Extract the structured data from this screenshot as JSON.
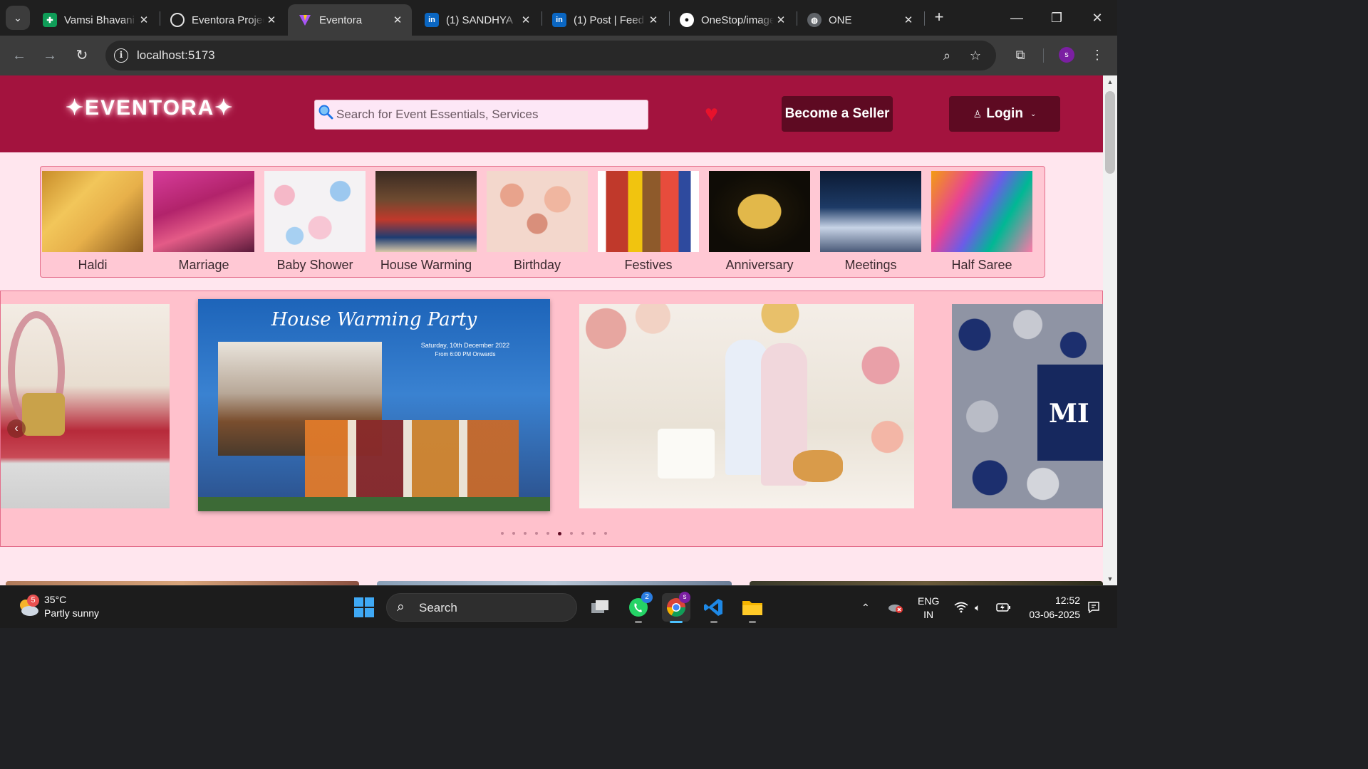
{
  "browser": {
    "tabs": [
      {
        "title": "Vamsi Bhavani",
        "favicon": "google-sheets-icon",
        "active": false
      },
      {
        "title": "Eventora Project",
        "favicon": "chatgpt-icon",
        "active": false
      },
      {
        "title": "Eventora",
        "favicon": "vite-icon",
        "active": true
      },
      {
        "title": "(1) SANDHYA",
        "favicon": "linkedin-icon",
        "active": false
      },
      {
        "title": "(1) Post | Feed",
        "favicon": "linkedin-icon",
        "active": false
      },
      {
        "title": "OneStop/images",
        "favicon": "github-icon",
        "active": false
      },
      {
        "title": "ONE",
        "favicon": "globe-icon",
        "active": false
      }
    ],
    "url": "localhost:5173",
    "profile_initial": "s"
  },
  "site": {
    "logo": "✦EVENTORA✦",
    "search_placeholder": "Search for Event Essentials, Services",
    "seller_button": "Become a Seller",
    "login_button": "Login",
    "brand_color": "#a3133e",
    "button_color": "#5e0a22",
    "categories": [
      {
        "label": "Haldi"
      },
      {
        "label": "Marriage"
      },
      {
        "label": "Baby Shower"
      },
      {
        "label": "House Warming"
      },
      {
        "label": "Birthday"
      },
      {
        "label": "Festives"
      },
      {
        "label": "Anniversary"
      },
      {
        "label": "Meetings"
      },
      {
        "label": "Half Saree"
      }
    ],
    "carousel": {
      "slides": [
        {
          "name": "stage-decoration"
        },
        {
          "name": "house-warming-invitation",
          "title": "House Warming Party",
          "date": "Saturday, 10th December 2022",
          "time": "From 6:00 PM Onwards"
        },
        {
          "name": "baby-shower-couple"
        },
        {
          "name": "balloon-decoration",
          "text": "MI"
        }
      ],
      "dot_count": 10,
      "active_dot": 5
    }
  },
  "taskbar": {
    "weather_temp": "35°C",
    "weather_desc": "Partly sunny",
    "weather_badge": "5",
    "search_label": "Search",
    "whatsapp_badge": "2",
    "chrome_badge": "s",
    "lang_line1": "ENG",
    "lang_line2": "IN",
    "time": "12:52",
    "date": "03-06-2025"
  }
}
